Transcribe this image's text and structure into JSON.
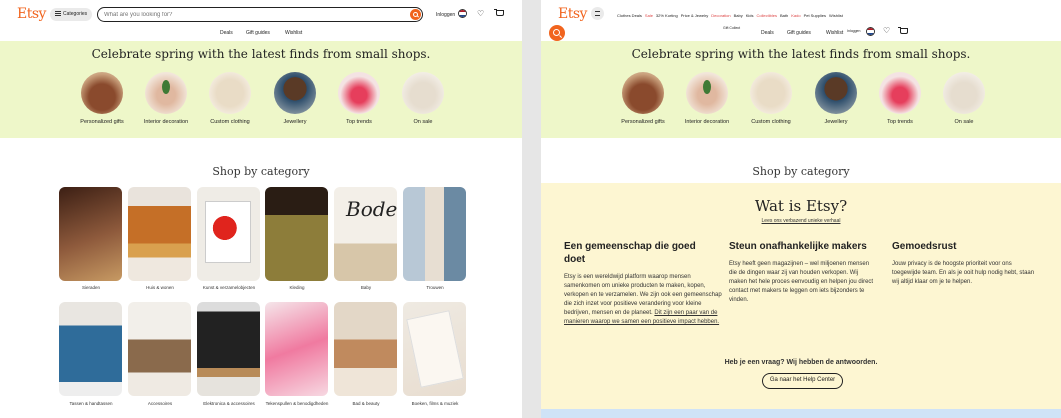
{
  "colors": {
    "brand": "#f1641e",
    "spring_band": "#eef7c9",
    "about_band": "#fdf6d2"
  },
  "left": {
    "logo": "Etsy",
    "categories_button": "Categories",
    "search_placeholder": "What are you looking for?",
    "login": "Inloggen",
    "subnav": [
      "Deals",
      "Gift guides",
      "Wishlist"
    ],
    "hero": "Celebrate spring with the latest finds from small shops.",
    "circles": [
      {
        "label": "Personalized gifts"
      },
      {
        "label": "Interior decoration"
      },
      {
        "label": "Custom clothing"
      },
      {
        "label": "Jewellery"
      },
      {
        "label": "Top trends"
      },
      {
        "label": "On sale"
      }
    ],
    "shop_by_category": "Shop by category",
    "categories": [
      "Sieraden",
      "Huis & wonen",
      "Kunst & verzamelobjecten",
      "Kleding",
      "Baby",
      "Trouwen",
      "Tassen & handtassen",
      "Accessoires",
      "Elektronica & accessoires",
      "Tekenspullen & benodigdheden",
      "Bad & beauty",
      "Boeken, films & muziek"
    ]
  },
  "right": {
    "logo": "Etsy",
    "nav_items": [
      "Clothes Deals",
      "Sale",
      "32% Korting",
      "Price & Jewelry",
      "Decoration",
      "Baby",
      "Kids",
      "Collectibles",
      "Bath",
      "Kado",
      "Pet Supplies",
      "Wishlist"
    ],
    "under_nav": "Gift Collect",
    "login": "Inloggen",
    "subnav": [
      "Deals",
      "Gift guides",
      "Wishlist"
    ],
    "hero": "Celebrate spring with the latest finds from small shops.",
    "circles": [
      {
        "label": "Personalized gifts"
      },
      {
        "label": "Interior decoration"
      },
      {
        "label": "Custom clothing"
      },
      {
        "label": "Jewellery"
      },
      {
        "label": "Top trends"
      },
      {
        "label": "On sale"
      }
    ],
    "shop_by_category": "Shop by category",
    "about": {
      "title": "Wat is Etsy?",
      "link": "Lees ons verbazend unieke verhaal",
      "cols": [
        {
          "title": "Een gemeenschap die goed doet",
          "body": "Etsy is een wereldwijd platform waarop mensen samenkomen om unieke producten te maken, kopen, verkopen en te verzamelen. We zijn ook een gemeenschap die zich inzet voor positieve verandering voor kleine bedrijven, mensen en de planeet.",
          "link": "Dit zijn een paar van de manieren waarop we samen een positieve impact hebben."
        },
        {
          "title": "Steun onafhankelijke makers",
          "body": "Etsy heeft geen magazijnen – wel miljoenen mensen die de dingen waar zij van houden verkopen. Wij maken het hele proces eenvoudig en helpen jou direct contact met makers te leggen om iets bijzonders te vinden."
        },
        {
          "title": "Gemoedsrust",
          "body": "Jouw privacy is de hoogste prioriteit voor ons toegewijde team. En als je ooit hulp nodig hebt, staan wij altijd klaar om je te helpen."
        }
      ],
      "faq": "Heb je een vraag? Wij hebben de antwoorden.",
      "help_button": "Ga naar het Help Center"
    }
  }
}
